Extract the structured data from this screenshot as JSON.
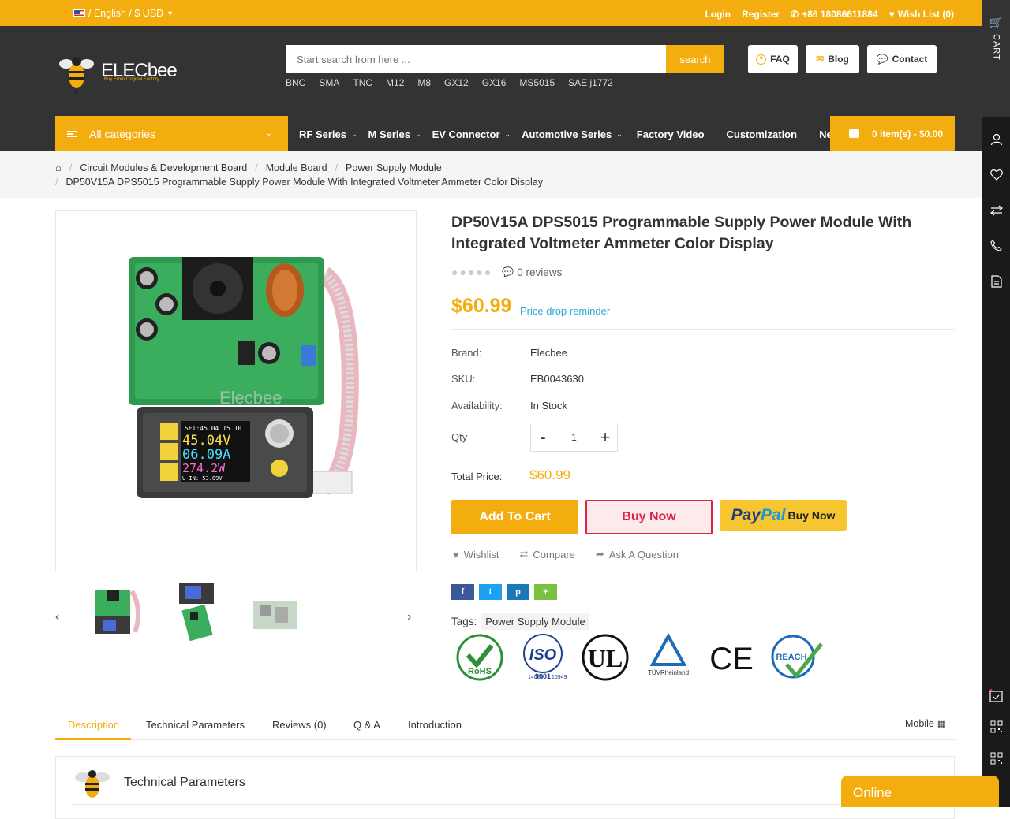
{
  "topbar": {
    "lang": "/ English / $ USD",
    "login": "Login",
    "register": "Register",
    "phone": "+86 18086611884",
    "wishlist": "Wish List (0)"
  },
  "header": {
    "logo_text": "ELECbee",
    "logo_tagline": "Buy From Original Factory",
    "search_placeholder": "Start search from here ...",
    "search_button": "search",
    "quick_links": [
      "BNC",
      "SMA",
      "TNC",
      "M12",
      "M8",
      "GX12",
      "GX16",
      "MS5015",
      "SAE j1772"
    ],
    "faq": "FAQ",
    "blog": "Blog",
    "contact": "Contact"
  },
  "nav": {
    "all_categories": "All categories",
    "items": [
      "RF Series",
      "M Series",
      "EV Connector",
      "Automotive Series",
      "Factory Video",
      "Customization",
      "Ne"
    ],
    "cart": "0 item(s) - $0.00"
  },
  "sidebar": {
    "cart_label": "CART"
  },
  "breadcrumb": {
    "items": [
      "Circuit Modules & Development Board",
      "Module Board",
      "Power Supply Module"
    ],
    "current": "DP50V15A DPS5015 Programmable Supply Power Module With Integrated Voltmeter Ammeter Color Display"
  },
  "product": {
    "image_watermark": "Elecbee",
    "display_lines": [
      "SET:45.04 15.10",
      "45.04V",
      "06.09A",
      "274.2W",
      "U-IN: 53.09V"
    ],
    "title": "DP50V15A DPS5015 Programmable Supply Power Module With Integrated Voltmeter Ammeter Color Display",
    "reviews": "0 reviews",
    "rating": 0,
    "price": "$60.99",
    "price_drop": "Price drop reminder",
    "brand_label": "Brand:",
    "brand": "Elecbee",
    "sku_label": "SKU:",
    "sku": "EB0043630",
    "availability_label": "Availability:",
    "availability": "In Stock",
    "qty_label": "Qty",
    "qty_minus": "-",
    "qty": "1",
    "qty_plus": "+",
    "total_label": "Total Price:",
    "total": "$60.99",
    "add_to_cart": "Add To Cart",
    "buy_now": "Buy Now",
    "paypal_pay": "Pay",
    "paypal_pal": "Pal",
    "paypal_buy": "Buy Now",
    "wishlist": "Wishlist",
    "compare": "Compare",
    "ask": "Ask A Question",
    "tags_label": "Tags:",
    "tag": "Power Supply Module"
  },
  "certs": {
    "rohs": "RoHS",
    "iso": "ISO",
    "iso_num": "9001",
    "iso_left": "14000",
    "iso_right": "16949",
    "ul": "UL",
    "tuv": "TÜVRheinland",
    "ce": "CE",
    "reach": "REACH"
  },
  "tabs": {
    "items": [
      "Description",
      "Technical Parameters",
      "Reviews (0)",
      "Q & A",
      "Introduction"
    ],
    "mobile": "Mobile"
  },
  "panel": {
    "title": "Technical Parameters"
  },
  "chat": {
    "status": "Online"
  },
  "colors": {
    "accent": "#f3ad0f",
    "header_bg": "#333333",
    "buy_now": "#d9234b",
    "link": "#29a8d8"
  }
}
